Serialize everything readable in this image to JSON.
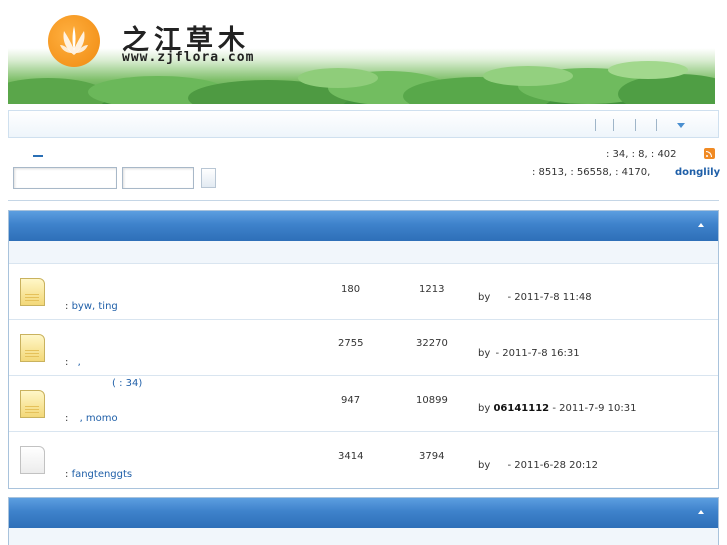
{
  "header": {
    "logo_title": "之江草木",
    "logo_url": "www.zjflora.com"
  },
  "stats": {
    "line1": ": 34,   : 8,   : 402",
    "line2": ": 8513,   : 56558,   : 4170,",
    "newest_user": "donglily"
  },
  "forum_sections": [
    {
      "rows": [
        {
          "icon": "new-posts-folder-icon",
          "today": "",
          "moderators_prefix": ":",
          "moderators": "byw, ting",
          "topics": "180",
          "posts": "1213",
          "last_by": "by",
          "last_user": "",
          "last_time": "- 2011-7-8 11:48"
        },
        {
          "icon": "new-posts-folder-icon",
          "today": "",
          "moderators_prefix": ":",
          "moderators": ",",
          "topics": "2755",
          "posts": "32270",
          "last_by": "by",
          "last_user": "",
          "last_time": "- 2011-7-8 16:31"
        },
        {
          "icon": "new-posts-folder-icon",
          "today": "( : 34)",
          "moderators_prefix": ":",
          "moderators": ", momo",
          "topics": "947",
          "posts": "10899",
          "last_by": "by",
          "last_user": "06141112",
          "last_time": "- 2011-7-9 10:31"
        },
        {
          "icon": "no-new-posts-folder-icon",
          "today": "",
          "moderators_prefix": ":",
          "moderators": "fangtenggts",
          "topics": "3414",
          "posts": "3794",
          "last_by": "by",
          "last_user": "",
          "last_time": "- 2011-6-28 20:12"
        }
      ]
    }
  ],
  "colors": {
    "panel_header": "#3e82cb",
    "link": "#1f5fa8",
    "rss": "#f08a24"
  }
}
